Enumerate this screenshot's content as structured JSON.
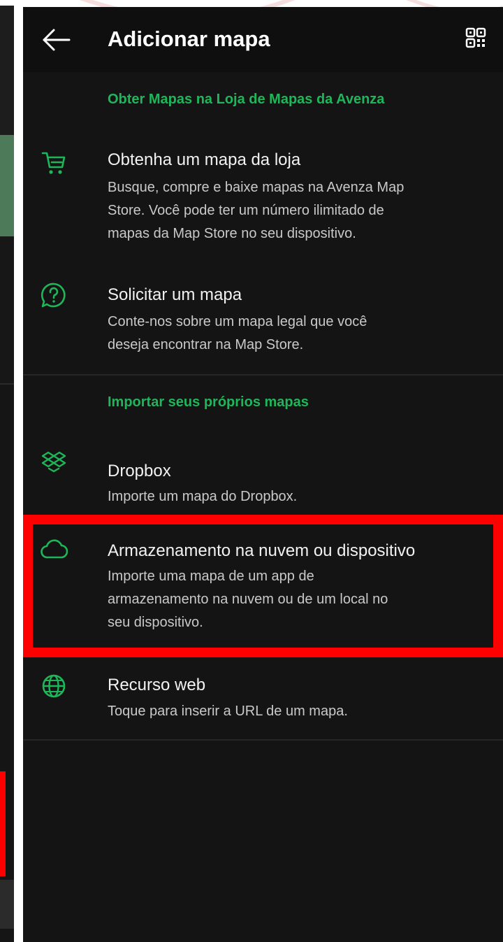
{
  "header": {
    "title": "Adicionar mapa",
    "back_icon": "arrow-left-icon",
    "qr_icon": "qr-code-icon"
  },
  "sections": [
    {
      "title": "Obter Mapas na Loja de Mapas da Avenza",
      "items": [
        {
          "icon": "shopping-cart-icon",
          "title": "Obtenha um mapa da loja",
          "desc_lines": [
            "Busque, compre e baixe mapas na Avenza Map",
            "Store. Você pode ter um número ilimitado de",
            "mapas da Map Store no seu dispositivo."
          ]
        },
        {
          "icon": "help-chat-icon",
          "title": "Solicitar um mapa",
          "desc_lines": [
            "Conte-nos sobre um mapa legal que você",
            "deseja encontrar na Map Store."
          ]
        }
      ]
    },
    {
      "title": "Importar seus próprios mapas",
      "items": [
        {
          "icon": "dropbox-icon",
          "title": "Dropbox",
          "desc_lines": [
            "Importe um mapa do Dropbox."
          ]
        },
        {
          "icon": "cloud-icon",
          "title": "Armazenamento na nuvem ou dispositivo",
          "desc_lines": [
            "Importe uma mapa de um app de",
            "armazenamento na nuvem ou de um local no",
            "seu dispositivo."
          ]
        },
        {
          "icon": "globe-icon",
          "title": "Recurso web",
          "desc_lines": [
            "Toque para inserir a URL de um mapa."
          ]
        }
      ]
    }
  ],
  "colors": {
    "accent": "#1fb65a",
    "background": "#141414",
    "highlight": "#ff0000"
  }
}
